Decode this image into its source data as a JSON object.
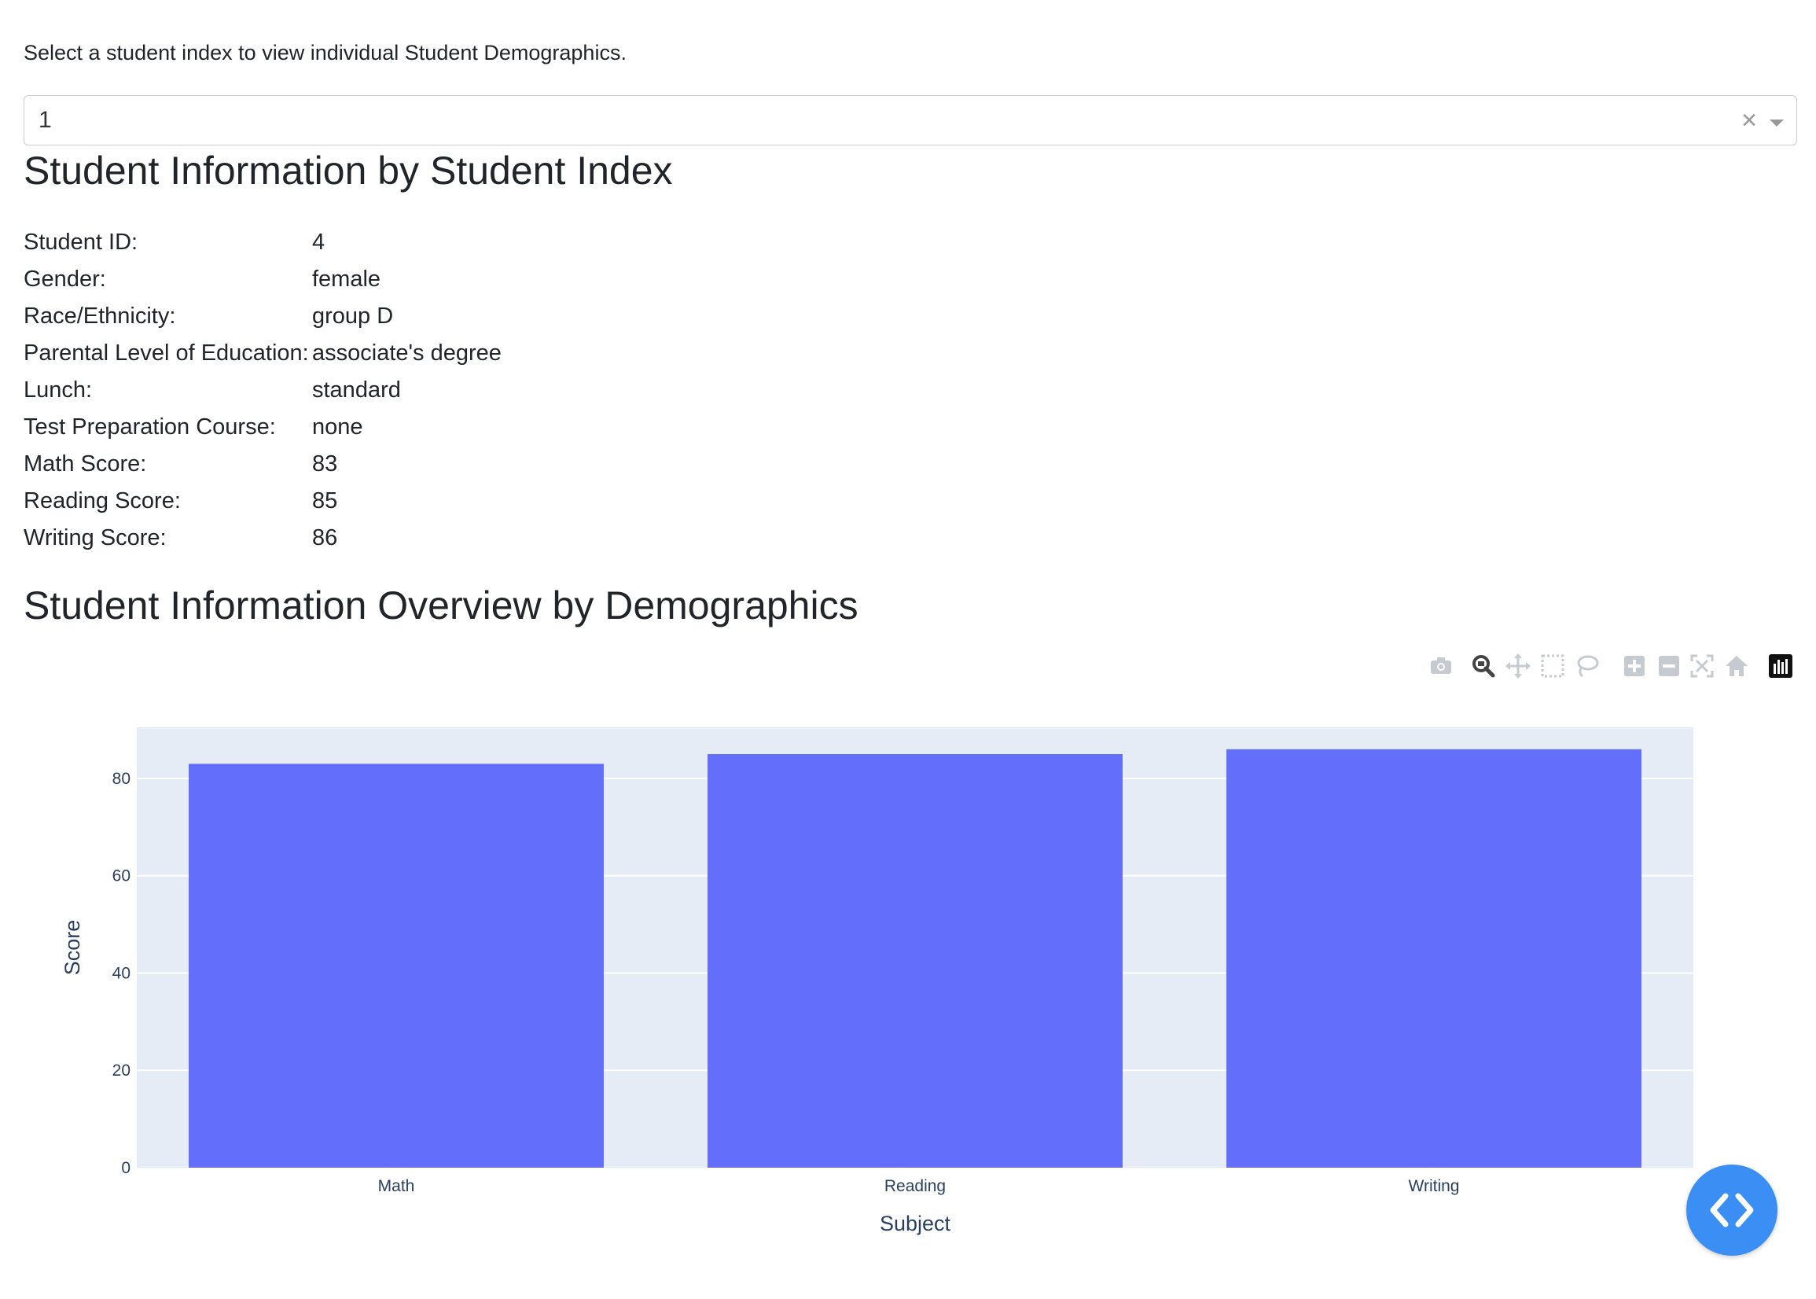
{
  "prompt": "Select a student index to view individual Student Demographics.",
  "dropdown": {
    "value": "1",
    "clear_icon": "×"
  },
  "info_heading": "Student Information by Student Index",
  "student_info": [
    {
      "label": "Student ID:",
      "value": "4"
    },
    {
      "label": "Gender:",
      "value": "female"
    },
    {
      "label": "Race/Ethnicity:",
      "value": "group D"
    },
    {
      "label": "Parental Level of Education:",
      "value": "associate's degree"
    },
    {
      "label": "Lunch:",
      "value": "standard"
    },
    {
      "label": "Test Preparation Course:",
      "value": "none"
    },
    {
      "label": "Math Score:",
      "value": "83"
    },
    {
      "label": "Reading Score:",
      "value": "85"
    },
    {
      "label": "Writing Score:",
      "value": "86"
    }
  ],
  "overview_heading": "Student Information Overview by Demographics",
  "modebar": [
    "camera-icon",
    "zoom-icon",
    "pan-icon",
    "box-select-icon",
    "lasso-icon",
    "zoom-in-icon",
    "zoom-out-icon",
    "autoscale-icon",
    "reset-axes-icon",
    "plotly-logo-icon"
  ],
  "colors": {
    "bar": "#636efa",
    "plot_bg": "#e5ecf6",
    "axis_text": "#2a3f5f",
    "fab": "#3b8ff4"
  },
  "chart_data": {
    "type": "bar",
    "categories": [
      "Math",
      "Reading",
      "Writing"
    ],
    "values": [
      83,
      85,
      86
    ],
    "xlabel": "Subject",
    "ylabel": "Score",
    "yticks": [
      "0",
      "20",
      "40",
      "60",
      "80"
    ],
    "ylim": [
      0,
      90.5
    ],
    "grid": true
  }
}
